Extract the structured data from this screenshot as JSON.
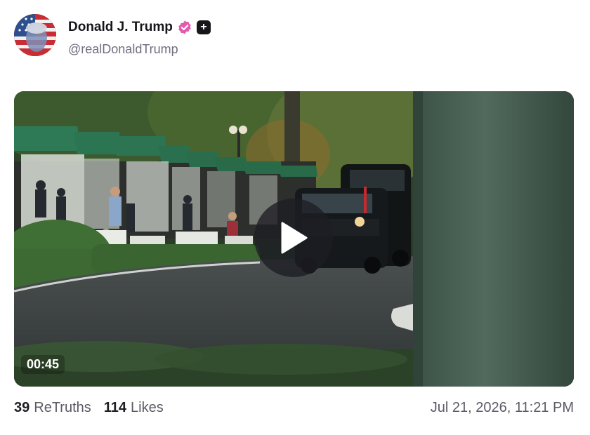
{
  "post": {
    "author": {
      "display_name": "Donald J. Trump",
      "handle": "@realDonaldTrump",
      "verified_icon": "verified-badge-icon",
      "plus_badge": "+",
      "badge_color": "#e35bb0"
    },
    "media": {
      "duration": "00:45",
      "play_icon": "play-icon"
    },
    "stats": {
      "retruths_count": "39",
      "retruths_label": "ReTruths",
      "likes_count": "114",
      "likes_label": "Likes"
    },
    "timestamp": "Jul 21, 2026, 11:21 PM"
  }
}
